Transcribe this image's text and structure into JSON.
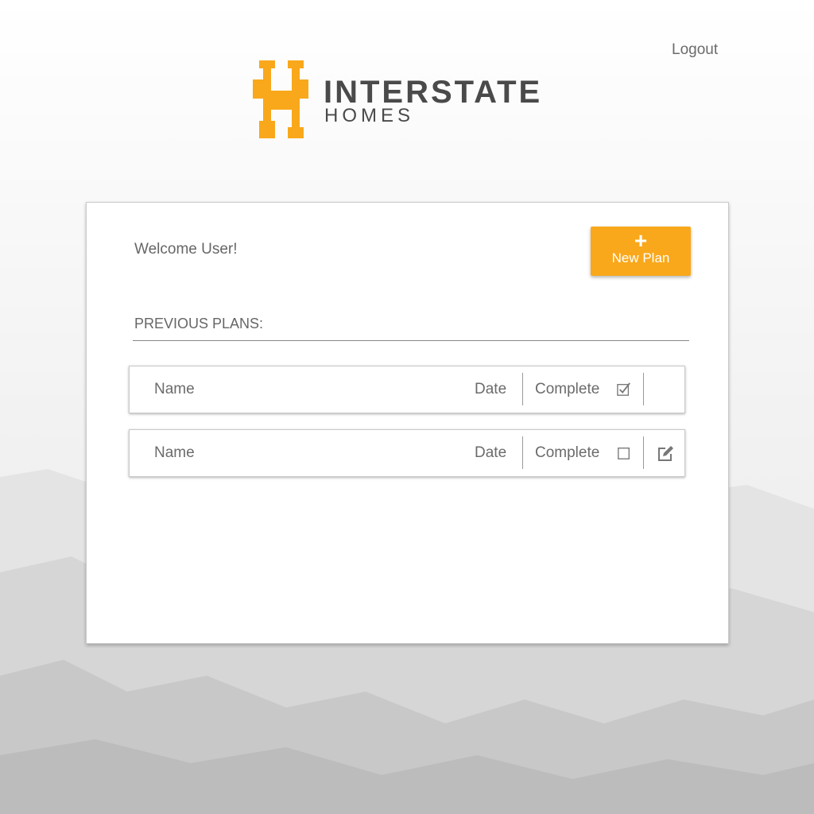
{
  "header": {
    "logout_label": "Logout",
    "brand_line1": "INTERSTATE",
    "brand_line2": "HOMES"
  },
  "colors": {
    "accent": "#f9a81b",
    "text": "#666666",
    "brand_text": "#4a4a4a"
  },
  "card": {
    "welcome": "Welcome User!",
    "new_plan_icon": "plus-icon",
    "new_plan_label": "New Plan",
    "section_title": "PREVIOUS PLANS:"
  },
  "plans": [
    {
      "name": "Name",
      "date": "Date",
      "complete_label": "Complete",
      "complete": true,
      "editable": false
    },
    {
      "name": "Name",
      "date": "Date",
      "complete_label": "Complete",
      "complete": false,
      "editable": true,
      "edit_icon": "edit-icon"
    }
  ]
}
